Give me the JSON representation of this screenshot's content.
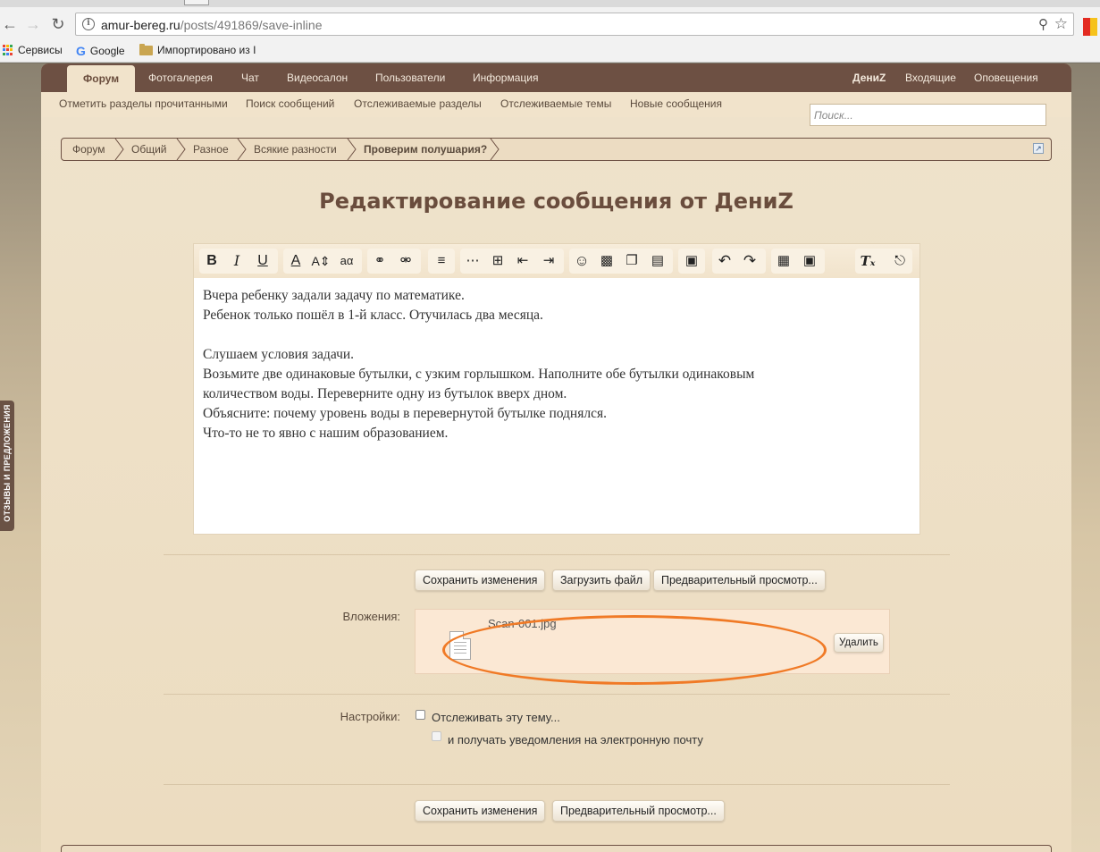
{
  "browser": {
    "url_host": "amur-bereg.ru",
    "url_path": "/posts/491869/save-inline",
    "bookmarks": [
      "Сервисы",
      "Google",
      "Импортировано из I"
    ]
  },
  "side_feedback": "ОТЗЫВЫ И ПРЕДЛОЖЕНИЯ",
  "topnav": {
    "tabs": [
      "Форум",
      "Фотогалерея",
      "Чат",
      "Видеосалон",
      "Пользователи",
      "Информация"
    ],
    "user": "ДениZ",
    "inbox": "Входящие",
    "alerts": "Оповещения"
  },
  "subnav": {
    "links": [
      "Отметить разделы прочитанными",
      "Поиск сообщений",
      "Отслеживаемые разделы",
      "Отслеживаемые темы",
      "Новые сообщения"
    ],
    "search_placeholder": "Поиск..."
  },
  "breadcrumb": [
    "Форум",
    "Общий",
    "Разное",
    "Всякие разности",
    "Проверим полушария?"
  ],
  "page_title": "Редактирование сообщения от ДениZ",
  "editor": {
    "lines": [
      "Вчера ребенку  задали задачу по математике.",
      "Ребенок только пошёл в 1-й класс. Отучилась два месяца.",
      "",
      "Слушаем условия задачи.",
      "Возьмите две одинаковые бутылки, с узким горлышком. Наполните обе бутылки одинаковым",
      "количеством воды. Переверните одну из бутылок вверх дном.",
      "Объясните: почему уровень воды в перевернутой бутылке поднялся.",
      "Что-то не то явно с нашим образованием."
    ]
  },
  "buttons": {
    "save": "Сохранить изменения",
    "upload": "Загрузить файл",
    "preview": "Предварительный просмотр...",
    "delete": "Удалить"
  },
  "attachments": {
    "label": "Вложения:",
    "file_name": "Scan-001.jpg"
  },
  "settings": {
    "label": "Настройки:",
    "watch_thread": "Отслеживать эту тему...",
    "email_notify": "и получать уведомления на электронную почту"
  },
  "colors": {
    "nav_brown": "#6d5043",
    "cream": "#f1e3cb",
    "annotation_orange": "#f07a26"
  }
}
